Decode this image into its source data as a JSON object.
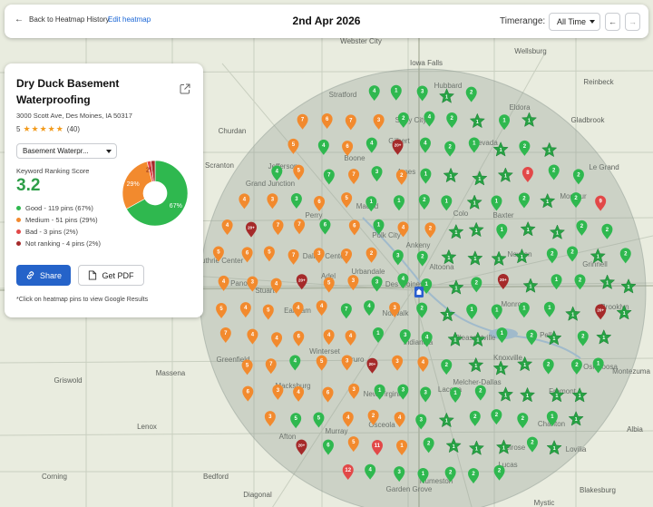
{
  "header": {
    "back_label": "Back to Heatmap History",
    "edit_label": "Edit heatmap",
    "date": "2nd Apr 2026",
    "timerange_label": "Timerange:",
    "timerange_value": "All Time"
  },
  "panel": {
    "business_name": "Dry Duck Basement Waterproofing",
    "address": "3000 Scott Ave, Des Moines, IA 50317",
    "rating": "5",
    "review_count": "(40)",
    "keyword": "Basement Waterpr...",
    "score_label": "Keyword Ranking Score",
    "score": "3.2",
    "legend": [
      {
        "label": "Good - 119 pins (67%)",
        "color": "#2fb84f"
      },
      {
        "label": "Medium - 51 pins (29%)",
        "color": "#f28a2e"
      },
      {
        "label": "Bad - 3 pins (2%)",
        "color": "#e24848"
      },
      {
        "label": "Not ranking - 4 pins (2%)",
        "color": "#a52a2a"
      }
    ],
    "pie": [
      {
        "label": "67%",
        "value": 67,
        "color": "#2fb84f"
      },
      {
        "label": "29%",
        "value": 29,
        "color": "#f28a2e"
      },
      {
        "label": "2%",
        "value": 2,
        "color": "#e24848"
      },
      {
        "label": "",
        "value": 2,
        "color": "#a52a2a"
      }
    ],
    "share_label": "Share",
    "pdf_label": "Get PDF",
    "hint": "*Click on heatmap pins to view Google Results"
  },
  "map": {
    "place_labels": [
      "Webster City",
      "Wellsburg",
      "Iowa Falls",
      "Reinbeck",
      "Stratford",
      "Hubbard",
      "Eldora",
      "Gladbrook",
      "Story City",
      "Churdan",
      "Gilbert",
      "Nevada",
      "Jefferson",
      "Boone",
      "Ames",
      "Le Grand",
      "Scranton",
      "Perry",
      "Madrid",
      "Colo",
      "Montour",
      "Grand Junction",
      "Baxter",
      "Polk City",
      "Ankeny",
      "Dallas Center",
      "Altoona",
      "Newton",
      "Urbandale",
      "Des Moines",
      "Grinnell",
      "Guthrie Center",
      "Adel",
      "Norwalk",
      "Monroe",
      "Brooklyn",
      "Panora",
      "Earlham",
      "Stuart",
      "Pleasantville",
      "Pella",
      "Winterset",
      "Knoxville",
      "Indianola",
      "Greenfield",
      "Massena",
      "Macksburg",
      "Melcher-Dallas",
      "Montezuma",
      "Oskaloosa",
      "New Virginia",
      "Lacona",
      "Griswold",
      "Lenox",
      "Afton",
      "Murray",
      "Osceola",
      "Chariton",
      "Albia",
      "Corning",
      "Humeston",
      "Lucas",
      "Diagonal",
      "Garden Grove",
      "Bedford",
      "Mystic",
      "Blakesburg",
      "Lovilia",
      "Melrose",
      "Truro",
      "Fremont"
    ]
  }
}
